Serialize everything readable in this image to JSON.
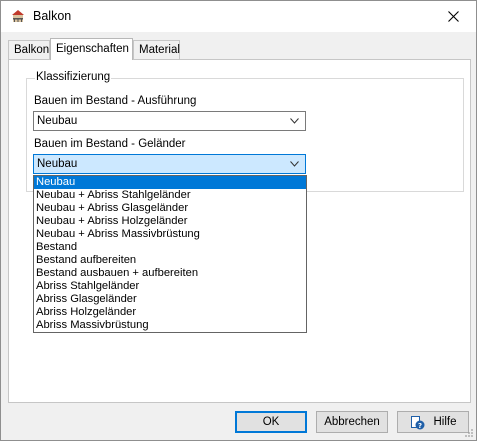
{
  "window": {
    "title": "Balkon"
  },
  "tabs": [
    {
      "label": "Balkon"
    },
    {
      "label": "Eigenschaften"
    },
    {
      "label": "Material"
    }
  ],
  "group": {
    "title": "Klassifizierung",
    "field1": {
      "label": "Bauen im Bestand - Ausführung",
      "value": "Neubau"
    },
    "field2": {
      "label": "Bauen im Bestand - Geländer",
      "value": "Neubau"
    }
  },
  "dropdown": {
    "selected_index": 0,
    "options": [
      "Neubau",
      "Neubau + Abriss  Stahlgeländer",
      "Neubau + Abriss  Glasgeländer",
      "Neubau + Abriss  Holzgeländer",
      "Neubau + Abriss Massivbrüstung",
      "Bestand",
      "Bestand aufbereiten",
      "Bestand ausbauen + aufbereiten",
      "Abriss Stahlgeländer",
      "Abriss Glasgeländer",
      "Abriss Holzgeländer",
      "Abriss Massivbrüstung"
    ]
  },
  "buttons": {
    "ok": "OK",
    "cancel": "Abbrechen",
    "help": "Hilfe"
  },
  "icons": {
    "app": "balcony-app-icon",
    "close": "close-icon",
    "help": "help-book-icon"
  },
  "colors": {
    "selection": "#0078d7",
    "focus_fill": "#cce8ff"
  }
}
